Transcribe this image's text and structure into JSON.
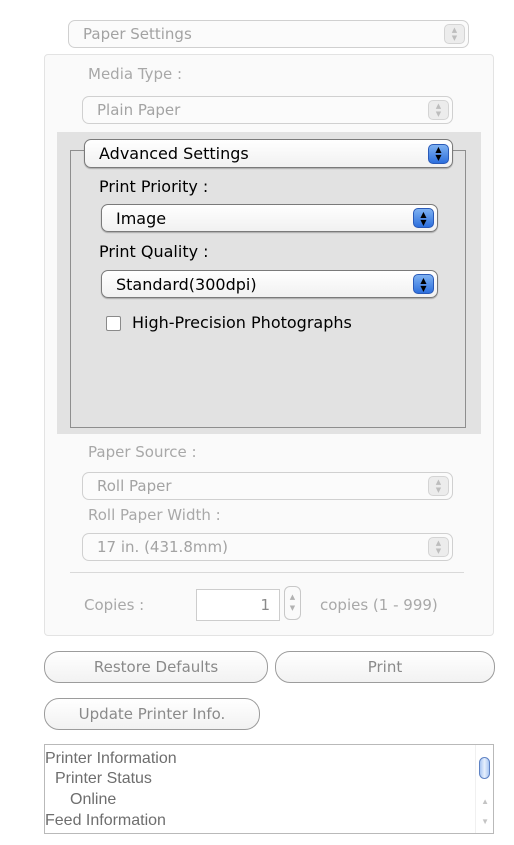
{
  "panel_select": {
    "value": "Paper Settings"
  },
  "media_type": {
    "label": "Media Type :",
    "value": "Plain Paper"
  },
  "advanced": {
    "select_value": "Advanced Settings",
    "print_priority": {
      "label": "Print Priority :",
      "value": "Image"
    },
    "print_quality": {
      "label": "Print Quality :",
      "value": "Standard(300dpi)"
    },
    "high_precision": {
      "label": "High-Precision Photographs",
      "checked": false
    }
  },
  "paper_source": {
    "label": "Paper Source :",
    "value": "Roll Paper"
  },
  "roll_paper_width": {
    "label": "Roll Paper Width :",
    "value": "17 in. (431.8mm)"
  },
  "copies": {
    "label": "Copies :",
    "value": "1",
    "range_text": "copies (1 - 999)"
  },
  "buttons": {
    "restore_defaults": "Restore Defaults",
    "print": "Print",
    "update_printer_info": "Update Printer Info."
  },
  "info_list": {
    "lines": [
      "Printer Information",
      "Printer Status",
      "Online",
      "Feed Information"
    ]
  },
  "colors": {
    "accent_arrows": "#2d6fdd",
    "panel_background": "#e2e2e2",
    "disabled_text": "#a3a3a3"
  },
  "icons": {
    "popup_arrows": "up-down-chevron-icon",
    "stepper": "stepper-arrows-icon"
  }
}
